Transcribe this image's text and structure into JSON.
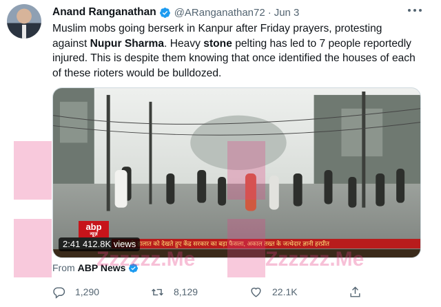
{
  "tweet": {
    "author_name": "Anand Ranganathan",
    "handle": "@ARanganathan72",
    "separator": "·",
    "date": "Jun 3",
    "body": {
      "part1": "Muslim mobs going berserk in Kanpur after Friday prayers, protesting against ",
      "bold1": "Nupur Sharma",
      "part2": ". Heavy ",
      "bold2": "stone",
      "part3": " pelting has led to 7 people reportedly injured. This is despite them knowing that once identified the houses of each of these rioters would be bulldozed."
    }
  },
  "media": {
    "video_time": "2:41",
    "view_count": "412.8K views",
    "channel_logo": "abp",
    "channel_logo_sub": "न्यूज़",
    "ticker_text": "पंजाब के हालात को देखते हुए केंद्र सरकार का बड़ा फैसला, अकाल तख्त के जत्थेदार ज्ञानी हरप्रीत"
  },
  "attribution": {
    "prefix": "From",
    "source": "ABP News"
  },
  "actions": {
    "replies": "1,290",
    "retweets": "8,129",
    "likes": "22.1K"
  },
  "watermark": {
    "text": "Zzzzzz.Me"
  },
  "colors": {
    "verified": "#1d9bf0",
    "text_secondary": "#536471",
    "ticker_bg": "#b81c1c",
    "logo_bg": "#c7141a"
  },
  "icons": [
    "verified-badge-icon",
    "more-icon",
    "reply-icon",
    "retweet-icon",
    "like-icon",
    "share-icon"
  ]
}
